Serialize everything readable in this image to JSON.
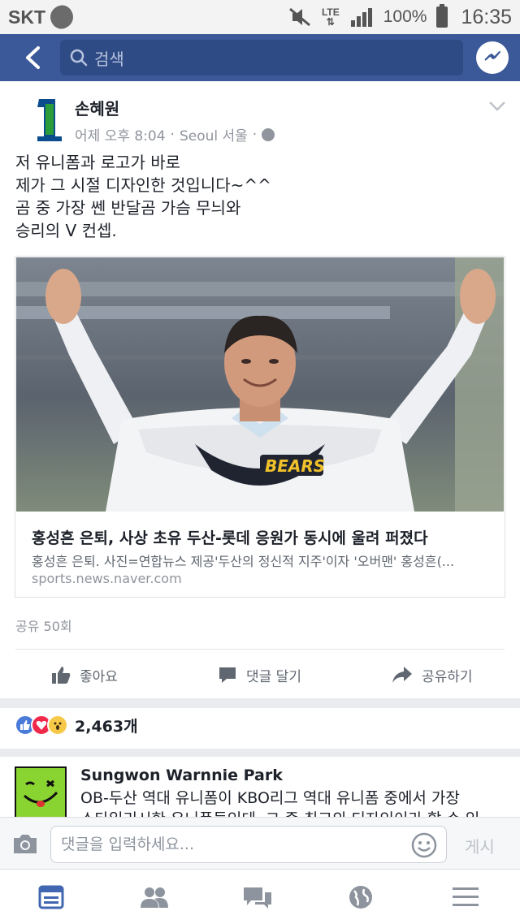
{
  "status_bar": {
    "carrier": "SKT",
    "network": "LTE",
    "battery": "100%",
    "time": "16:35"
  },
  "header": {
    "search_placeholder": "검색"
  },
  "post": {
    "author": "손혜원",
    "timestamp": "어제 오후 8:04",
    "location": "Seoul 서울",
    "privacy_icon": "globe-icon",
    "body_lines": [
      "저 유니폼과 로고가 바로",
      "제가 그 시절 디자인한 것입니다~^^",
      "곰 중 가장 쎈 반달곰 가슴 무늬와",
      "승리의 V 컨셉."
    ],
    "link": {
      "jersey_text": "BEARS",
      "title": "홍성흔 은퇴, 사상 초유 두산-롯데 응원가 동시에 울려 퍼졌다",
      "description": "홍성흔 은퇴. 사진=연합뉴스 제공'두산의 정신적 지주'이자 '오버맨' 홍성흔(...",
      "domain": "sports.news.naver.com"
    },
    "share_count": "공유 50회",
    "actions": {
      "like": "좋아요",
      "comment": "댓글 달기",
      "share": "공유하기"
    },
    "reactions": {
      "count": "2,463개",
      "types": [
        "like",
        "love",
        "wow"
      ]
    }
  },
  "comment": {
    "author": "Sungwon Warnnie Park",
    "text_line1": "OB-두산 역대 유니폼이 KBO리그 역대 유니폼 중에서 가장",
    "text_line2": "스타일리시한 유니폼들인데, 그 중 최고의 디자인이라 할 수 있"
  },
  "composer": {
    "placeholder": "댓글을 입력하세요...",
    "post_label": "게시"
  },
  "bottom_nav": [
    "news-feed",
    "friends",
    "messages",
    "notifications",
    "menu"
  ],
  "colors": {
    "brand": "#3b5998",
    "nav_active": "#4267b2",
    "nav_inactive": "#8d949e"
  }
}
